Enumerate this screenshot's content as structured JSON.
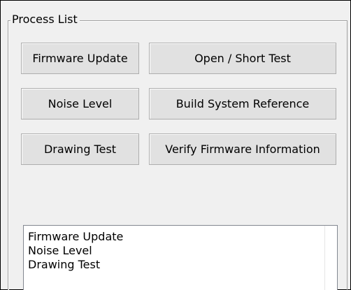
{
  "group": {
    "title": "Process List"
  },
  "buttons": {
    "firmware_update": "Firmware Update",
    "open_short_test": "Open / Short Test",
    "noise_level": "Noise Level",
    "build_system_reference": "Build System Reference",
    "drawing_test": "Drawing Test",
    "verify_firmware_information": "Verify Firmware Information"
  },
  "process_list": {
    "items": [
      "Firmware Update",
      "Noise Level",
      "Drawing Test"
    ]
  },
  "colors": {
    "window_bg": "#f0f0f0",
    "button_bg": "#e1e1e1",
    "button_border": "#adadad",
    "list_bg": "#ffffff"
  }
}
